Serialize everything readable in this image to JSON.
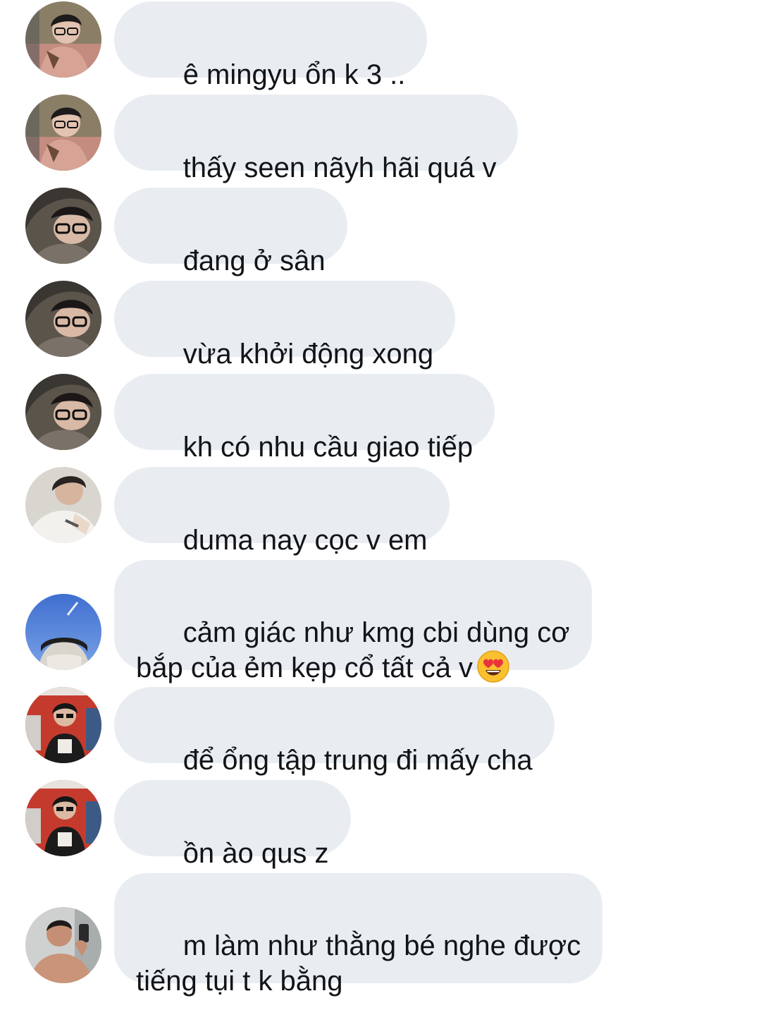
{
  "messages": [
    {
      "text": "ê mingyu ổn k 3 .."
    },
    {
      "text": "thấy seen nãyh hãi quá v"
    },
    {
      "text": "đang ở sân"
    },
    {
      "text": "vừa khởi động xong"
    },
    {
      "text": "kh có nhu cầu giao tiếp"
    },
    {
      "text": "duma nay cọc v em"
    },
    {
      "text": "cảm giác như kmg cbi dùng cơ\nbắp của ẻm kẹp cổ tất cả v",
      "emoji": "heart-eyes-emoji"
    },
    {
      "text": "để ổng tập trung đi mấy cha"
    },
    {
      "text": "ồn ào qus z"
    },
    {
      "text": "m làm như thằng bé nghe được\ntiếng tụi t k bằng"
    }
  ],
  "colors": {
    "bubble": "#e9edf1",
    "text": "#111418",
    "background": "#ffffff"
  },
  "avatars": [
    "avatar-glasses-pink",
    "avatar-glasses-pink",
    "avatar-hood-glasses",
    "avatar-hood-glasses",
    "avatar-hood-glasses",
    "avatar-white-shirt",
    "avatar-blue-sky",
    "avatar-red-store",
    "avatar-red-store",
    "avatar-mirror-selfie"
  ]
}
